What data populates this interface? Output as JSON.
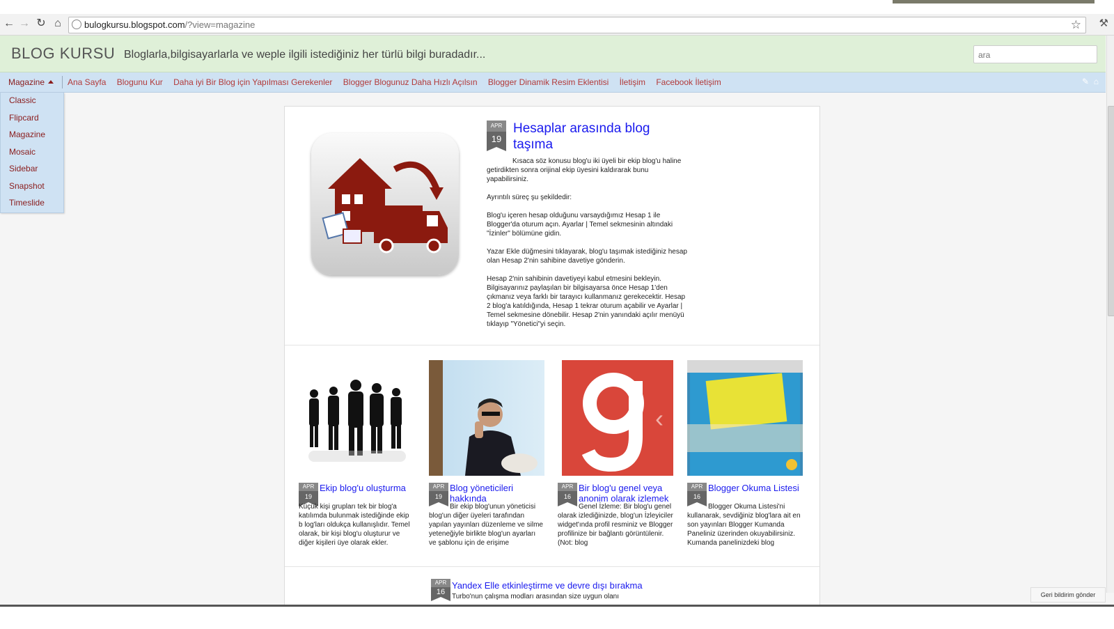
{
  "browser": {
    "url_host": "bulogkursu.blogspot.com",
    "url_path": "/?view=magazine"
  },
  "blog": {
    "title": "BLOG KURSU",
    "description": "Bloglarla,bilgisayarlarla ve weple ilgili istediğiniz her türlü bilgi buradadır...",
    "search_placeholder": "ara"
  },
  "navbar": {
    "view_label": "Magazine",
    "links": [
      "Ana Sayfa",
      "Blogunu Kur",
      "Daha iyi Bir Blog için Yapılması Gerekenler",
      "Blogger Blogunuz Daha Hızlı Açılsın",
      "Blogger Dinamik Resim Eklentisi",
      "İletişim",
      "Facebook İletişim"
    ]
  },
  "views_menu": [
    "Classic",
    "Flipcard",
    "Magazine",
    "Mosaic",
    "Sidebar",
    "Snapshot",
    "Timeslide"
  ],
  "featured": {
    "month": "APR",
    "day": "19",
    "title": "Hesaplar arasında blog taşıma",
    "paragraphs": [
      "Kısaca söz konusu blog'u iki üyeli bir ekip blog'u haline getirdikten sonra orijinal ekip üyesini kaldırarak bunu yapabilirsiniz.",
      "Ayrıntılı süreç şu şekildedir:",
      "Blog'u içeren hesap olduğunu varsaydığımız Hesap 1 ile Blogger'da oturum açın. Ayarlar | Temel sekmesinin altındaki \"İzinler\" bölümüne gidin.",
      "Yazar Ekle düğmesini tıklayarak, blog'u taşımak istediğiniz hesap olan Hesap 2'nin sahibine davetiye gönderin.",
      "Hesap 2'nin sahibinin davetiyeyi kabul etmesini bekleyin. Bilgisayarınız paylaşılan bir bilgisayarsa önce Hesap 1'den çıkmanız veya farklı bir tarayıcı kullanmanız gerekecektir. Hesap 2 blog'a katıldığında, Hesap 1 tekrar oturum açabilir ve Ayarlar | Temel sekmesine dönebilir. Hesap 2'nin yanındaki açılır menüyü tıklayıp \"Yönetici\"yi seçin."
    ]
  },
  "posts": [
    {
      "month": "APR",
      "day": "19",
      "title": "Ekip blog'u oluşturma",
      "excerpt": "Küçük kişi grupları tek bir blog'a katılımda bulunmak istediğinde ekip b log'ları oldukça kullanışlıdır. Temel olarak, bir kişi blog'u oluşturur ve diğer kişileri üye olarak ekler."
    },
    {
      "month": "APR",
      "day": "19",
      "title": "Blog yöneticileri hakkında",
      "excerpt": "Bir ekip blog'unun yöneticisi blog'un diğer üyeleri tarafından yapılan yayınları düzenleme ve silme yeteneğiyle birlikte blog'un ayarları ve şablonu için de erişime"
    },
    {
      "month": "APR",
      "day": "16",
      "title": "Bir blog'u genel veya anonim olarak izlemek",
      "excerpt": "Genel İzleme: Bir blog'u genel olarak izlediğinizde, blog'un İzleyiciler widget'ında profil resminiz ve Blogger profilinize bir bağlantı görüntülenir. (Not: blog"
    },
    {
      "month": "APR",
      "day": "16",
      "title": "Blogger Okuma Listesi",
      "excerpt": "Blogger Okuma Listesi'ni kullanarak, sevdiğiniz blog'lara ait en son yayınları Blogger Kumanda Paneliniz üzerinden okuyabilirsiniz. Kumanda panelinizdeki blog"
    }
  ],
  "next_post": {
    "month": "APR",
    "day": "16",
    "title": "Yandex Elle etkinleştirme ve devre dışı bırakma",
    "excerpt": "Turbo'nun çalışma modları arasından size uygun olanı"
  },
  "feedback_label": "Geri bildirim gönder",
  "colors": {
    "header_bg": "#dff0d8",
    "navbar_bg": "#cfe2f3",
    "link_red": "#b23a3a",
    "post_title_blue": "#1a1aee"
  }
}
